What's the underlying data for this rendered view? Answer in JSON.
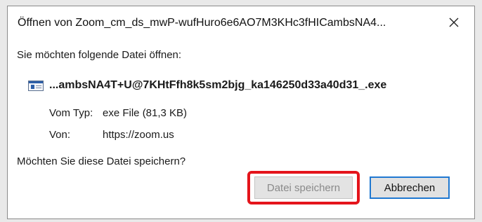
{
  "dialog": {
    "title": "Öffnen von Zoom_cm_ds_mwP-wufHuro6e6AO7M3KHc3fHICambsNA4...",
    "close_icon": "close-icon",
    "prompt": "Sie möchten folgende Datei öffnen:",
    "file_icon": "executable-file-icon",
    "filename": "...ambsNA4T+U@7KHtFfh8k5sm2bjg_ka146250d33a40d31_.exe",
    "type_label": "Vom Typ:",
    "type_value": "exe File (81,3 KB)",
    "from_label": "Von:",
    "from_value": "https://zoom.us",
    "question": "Möchten Sie diese Datei speichern?",
    "save_label": "Datei speichern",
    "cancel_label": "Abbrechen"
  },
  "colors": {
    "highlight": "#e4141b",
    "focus_border": "#1f78d1"
  }
}
